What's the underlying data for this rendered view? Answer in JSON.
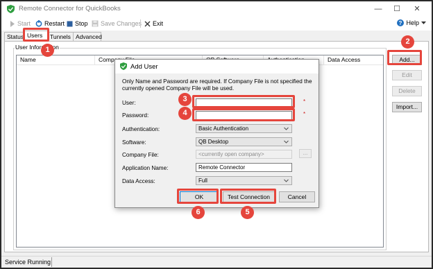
{
  "window": {
    "title": "Remote Connector for QuickBooks",
    "minimize": "—",
    "maximize": "☐",
    "close": "✕"
  },
  "toolbar": {
    "start": "Start",
    "restart": "Restart",
    "stop": "Stop",
    "save_changes": "Save Changes",
    "exit": "Exit",
    "help": "Help"
  },
  "tabs": [
    {
      "label": "Status"
    },
    {
      "label": "Users"
    },
    {
      "label": "Tunnels"
    },
    {
      "label": "Advanced"
    }
  ],
  "users_panel": {
    "group_label": "User Information",
    "columns": [
      "Name",
      "Company File",
      "QB Software",
      "Authentication",
      "Data Access"
    ],
    "buttons": {
      "add": "Add...",
      "edit": "Edit",
      "delete": "Delete",
      "import": "Import..."
    }
  },
  "status_bar": {
    "text": "Service Running"
  },
  "dialog": {
    "title": "Add User",
    "note": "Only Name and Password are required. If Company File is not specified the currently opened Company File will be used.",
    "required_marker": "*",
    "fields": {
      "user_label": "User:",
      "user_value": "",
      "password_label": "Password:",
      "password_value": "",
      "authentication_label": "Authentication:",
      "authentication_value": "Basic Authentication",
      "software_label": "Software:",
      "software_value": "QB Desktop",
      "company_file_label": "Company File:",
      "company_file_placeholder": "<currently open company>",
      "browse": "...",
      "app_name_label": "Application Name:",
      "app_name_value": "Remote Connector",
      "data_access_label": "Data Access:",
      "data_access_value": "Full"
    },
    "buttons": {
      "ok": "OK",
      "test_connection": "Test Connection",
      "cancel": "Cancel"
    }
  },
  "annotations": [
    "1",
    "2",
    "3",
    "4",
    "5",
    "6"
  ],
  "colors": {
    "annotation": "#e5453c",
    "app_icon": "#2e9e3f",
    "required": "#cc1a1a",
    "restart_icon": "#1f6fbf",
    "stop_icon": "#2c5f9e",
    "help_icon": "#1f6fbf"
  }
}
